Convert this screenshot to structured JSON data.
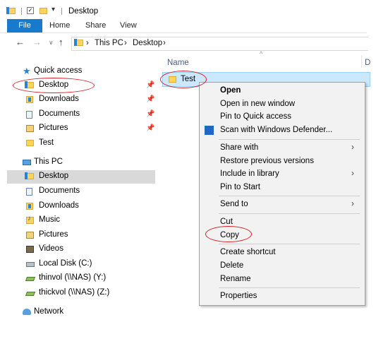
{
  "window": {
    "title": "Desktop"
  },
  "ribbon": {
    "tabs": [
      "File",
      "Home",
      "Share",
      "View"
    ]
  },
  "address": {
    "segments": [
      "This PC",
      "Desktop"
    ],
    "separator": "›"
  },
  "nav_pane": {
    "quick_access": {
      "label": "Quick access",
      "items": [
        {
          "label": "Desktop",
          "icon": "desktop-folder-icon",
          "pinned": true
        },
        {
          "label": "Downloads",
          "icon": "downloads-icon",
          "pinned": true
        },
        {
          "label": "Documents",
          "icon": "documents-icon",
          "pinned": true
        },
        {
          "label": "Pictures",
          "icon": "pictures-icon",
          "pinned": true
        },
        {
          "label": "Test",
          "icon": "folder-icon",
          "pinned": false
        }
      ]
    },
    "this_pc": {
      "label": "This PC",
      "items": [
        {
          "label": "Desktop",
          "selected": true
        },
        {
          "label": "Documents"
        },
        {
          "label": "Downloads"
        },
        {
          "label": "Music"
        },
        {
          "label": "Pictures"
        },
        {
          "label": "Videos"
        },
        {
          "label": "Local Disk (C:)"
        },
        {
          "label": "thinvol (\\\\NAS) (Y:)"
        },
        {
          "label": "thickvol (\\\\NAS) (Z:)"
        }
      ]
    },
    "network": {
      "label": "Network"
    }
  },
  "content": {
    "columns": [
      "Name",
      "D"
    ],
    "files": [
      {
        "name": "Test",
        "selected": true
      }
    ]
  },
  "context_menu": {
    "groups": [
      [
        "Open",
        "Open in new window",
        "Pin to Quick access",
        "Scan with Windows Defender..."
      ],
      [
        "Share with",
        "Restore previous versions",
        "Include in library",
        "Pin to Start"
      ],
      [
        "Send to"
      ],
      [
        "Cut",
        "Copy"
      ],
      [
        "Create shortcut",
        "Delete",
        "Rename"
      ],
      [
        "Properties"
      ]
    ]
  },
  "colors": {
    "accent": "#1979ca",
    "selection": "#cce8ff",
    "highlight_ellipse": "#d61f26"
  }
}
